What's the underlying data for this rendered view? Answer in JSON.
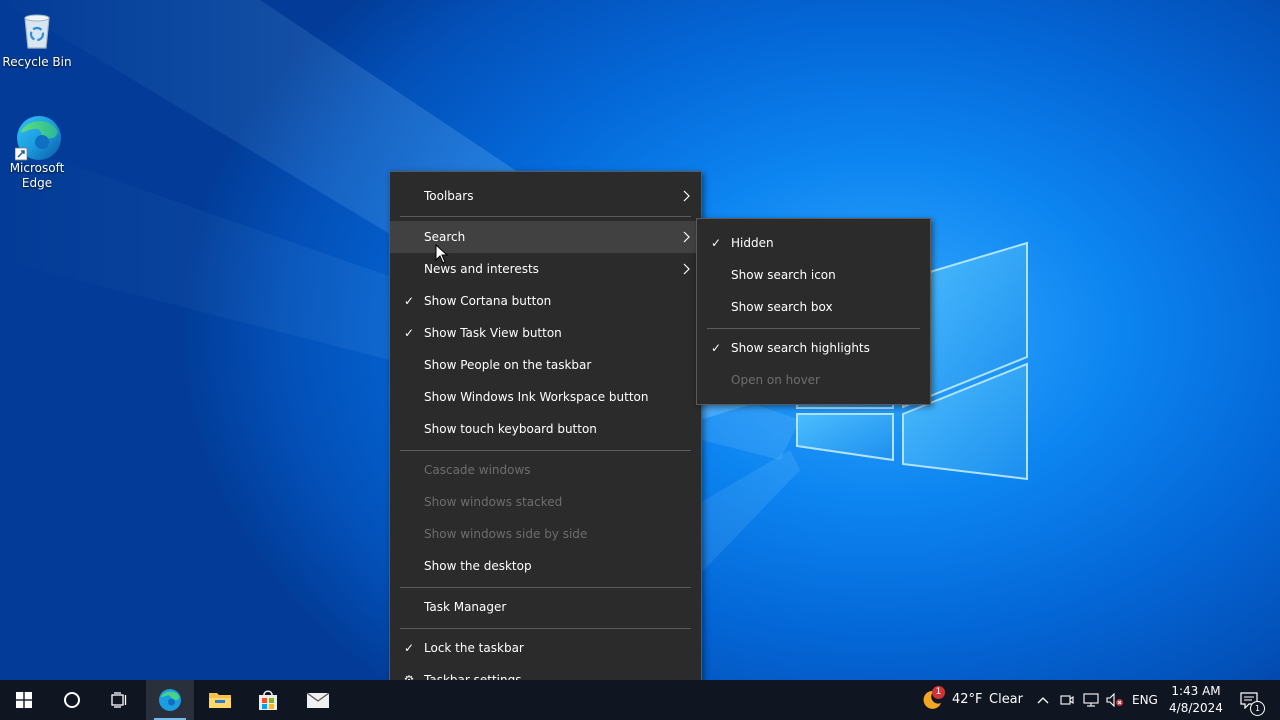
{
  "desktop": {
    "icons": [
      {
        "label": "Recycle Bin",
        "icon": "recycle-bin-icon"
      },
      {
        "label": "Microsoft Edge",
        "label_line1": "Microsoft",
        "label_line2": "Edge",
        "icon": "edge-icon"
      }
    ]
  },
  "context_menu": {
    "items": [
      {
        "label": "Toolbars",
        "submenu": true
      },
      {
        "label": "Search",
        "submenu": true,
        "hovered": true
      },
      {
        "label": "News and interests",
        "submenu": true
      },
      {
        "label": "Show Cortana button",
        "checked": true
      },
      {
        "label": "Show Task View button",
        "checked": true
      },
      {
        "label": "Show People on the taskbar"
      },
      {
        "label": "Show Windows Ink Workspace button"
      },
      {
        "label": "Show touch keyboard button"
      },
      {
        "label": "Cascade windows",
        "disabled": true
      },
      {
        "label": "Show windows stacked",
        "disabled": true
      },
      {
        "label": "Show windows side by side",
        "disabled": true
      },
      {
        "label": "Show the desktop"
      },
      {
        "label": "Task Manager"
      },
      {
        "label": "Lock the taskbar",
        "checked": true
      },
      {
        "label": "Taskbar settings",
        "icon": "gear-icon"
      }
    ]
  },
  "search_submenu": {
    "items": [
      {
        "label": "Hidden",
        "checked": true
      },
      {
        "label": "Show search icon"
      },
      {
        "label": "Show search box"
      },
      {
        "label": "Show search highlights",
        "checked": true
      },
      {
        "label": "Open on hover",
        "disabled": true
      }
    ]
  },
  "taskbar": {
    "apps": [
      "start-icon",
      "cortana-icon",
      "task-view-icon",
      "edge-icon",
      "file-explorer-icon",
      "store-icon",
      "mail-icon"
    ],
    "weather": {
      "temp": "42°F",
      "condition": "Clear",
      "badge": "1"
    },
    "language": "ENG",
    "time": "1:43 AM",
    "date": "4/8/2024",
    "notification_count": "1"
  },
  "colors": {
    "menu_bg": "#2b2b2b",
    "menu_hover": "#414141",
    "disabled_text": "#6d6d6d",
    "taskbar_bg": "#101522",
    "accent": "#76b9ed"
  }
}
